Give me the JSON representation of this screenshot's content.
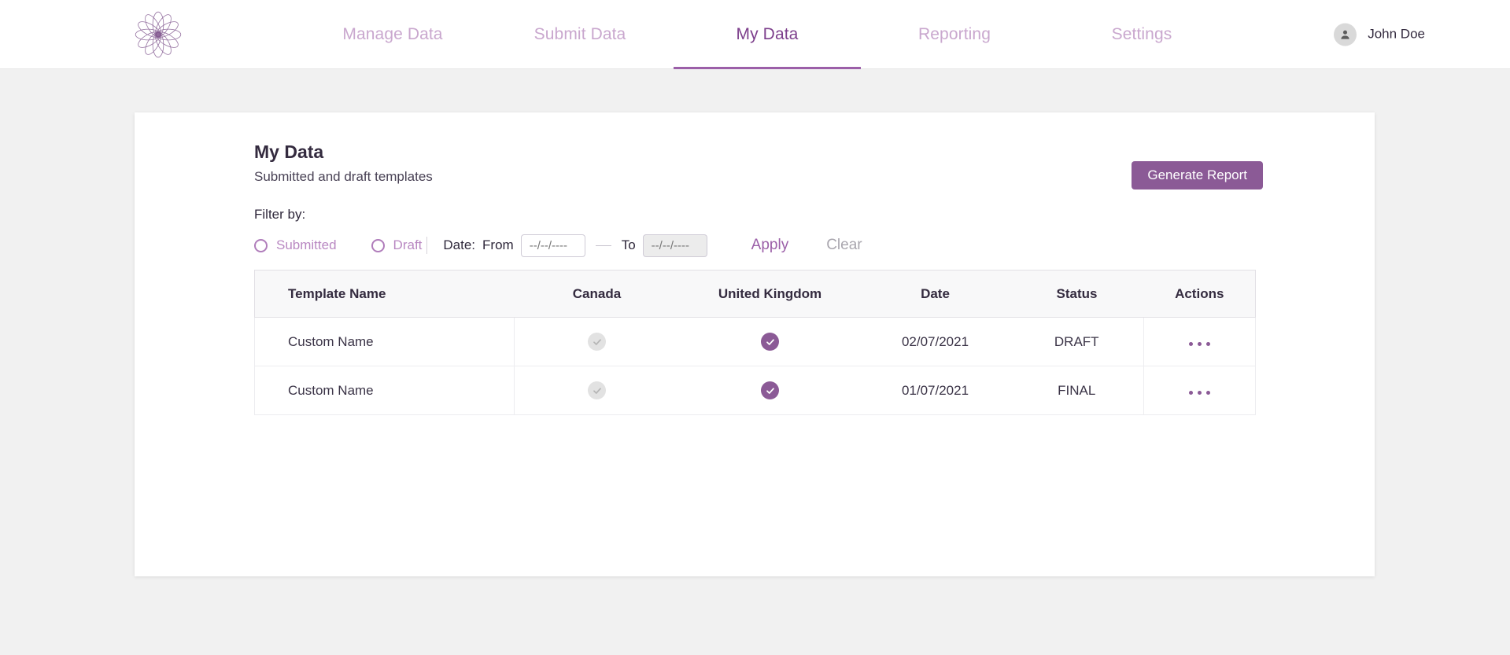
{
  "brand": {
    "logo_icon": "mandala-flower-logo",
    "accent_color": "#8b5a96",
    "accent_light": "#c9a7ce",
    "text_dark": "#342b3f"
  },
  "nav": {
    "items": [
      {
        "label": "Manage Data",
        "active": false
      },
      {
        "label": "Submit Data",
        "active": false
      },
      {
        "label": "My Data",
        "active": true
      },
      {
        "label": "Reporting",
        "active": false
      },
      {
        "label": "Settings",
        "active": false
      }
    ]
  },
  "user": {
    "name": "John Doe",
    "avatar_icon": "person-icon"
  },
  "page": {
    "title": "My Data",
    "subtitle": "Submitted and draft templates",
    "generate_report_label": "Generate Report"
  },
  "filters": {
    "label": "Filter by:",
    "radios": [
      {
        "label": "Submitted",
        "selected": false
      },
      {
        "label": "Draft",
        "selected": false
      }
    ],
    "date_label": "Date:",
    "from_label": "From",
    "to_label": "To",
    "from_value": "",
    "from_placeholder": "--/--/----",
    "to_value": "",
    "to_placeholder": "--/--/----",
    "apply_label": "Apply",
    "clear_label": "Clear"
  },
  "table": {
    "columns": [
      "Template Name",
      "Canada",
      "United Kingdom",
      "Date",
      "Status",
      "Actions"
    ],
    "rows": [
      {
        "name": "Custom Name",
        "canada": false,
        "united_kingdom": true,
        "date": "02/07/2021",
        "status": "DRAFT",
        "actions_icon": "more-horizontal-icon"
      },
      {
        "name": "Custom Name",
        "canada": false,
        "united_kingdom": true,
        "date": "01/07/2021",
        "status": "FINAL",
        "actions_icon": "more-horizontal-icon"
      }
    ]
  }
}
